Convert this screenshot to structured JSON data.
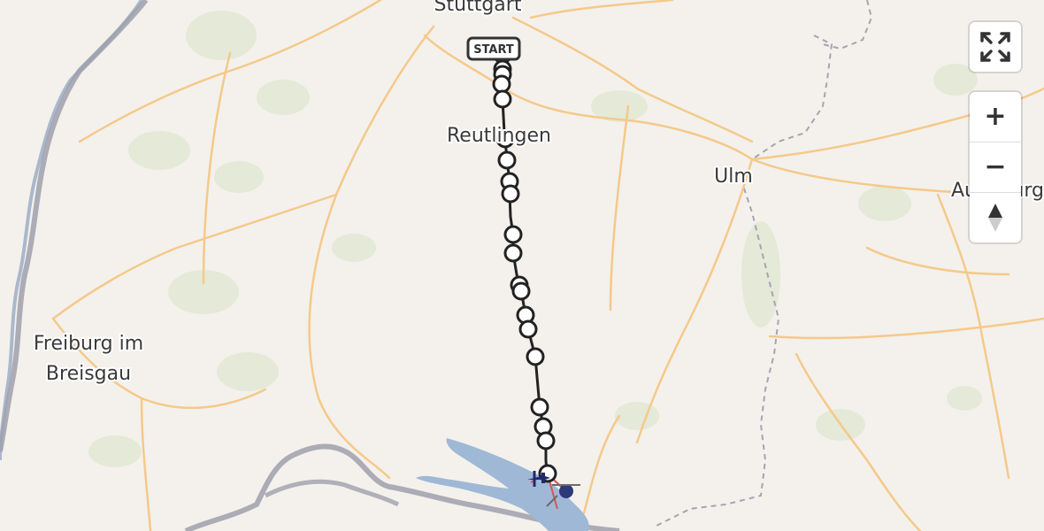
{
  "map": {
    "cities": [
      {
        "name": "Stuttgart",
        "label": "Stuttgart"
      },
      {
        "name": "Reutlingen",
        "label": "Reutlingen"
      },
      {
        "name": "Ulm",
        "label": "Ulm"
      },
      {
        "name": "Augsburg",
        "label": "Augsburg"
      },
      {
        "name": "Freiburg im Breisgau",
        "label_line1": "Freiburg im",
        "label_line2": "Breisgau"
      }
    ],
    "start_marker": {
      "label": "START"
    },
    "route": {
      "color": "#222222",
      "stop_count": 24
    },
    "colors": {
      "land": "#f4f1ec",
      "forest": "#e3e8d6",
      "roads": "#f5c98a",
      "water": "#9fb8d6",
      "border": "#9da0ab",
      "rhine": "#aab8cc"
    }
  },
  "controls": {
    "fullscreen_icon": "fullscreen-icon",
    "zoom_in": "+",
    "zoom_out": "−",
    "compass_icon": "compass-icon"
  }
}
